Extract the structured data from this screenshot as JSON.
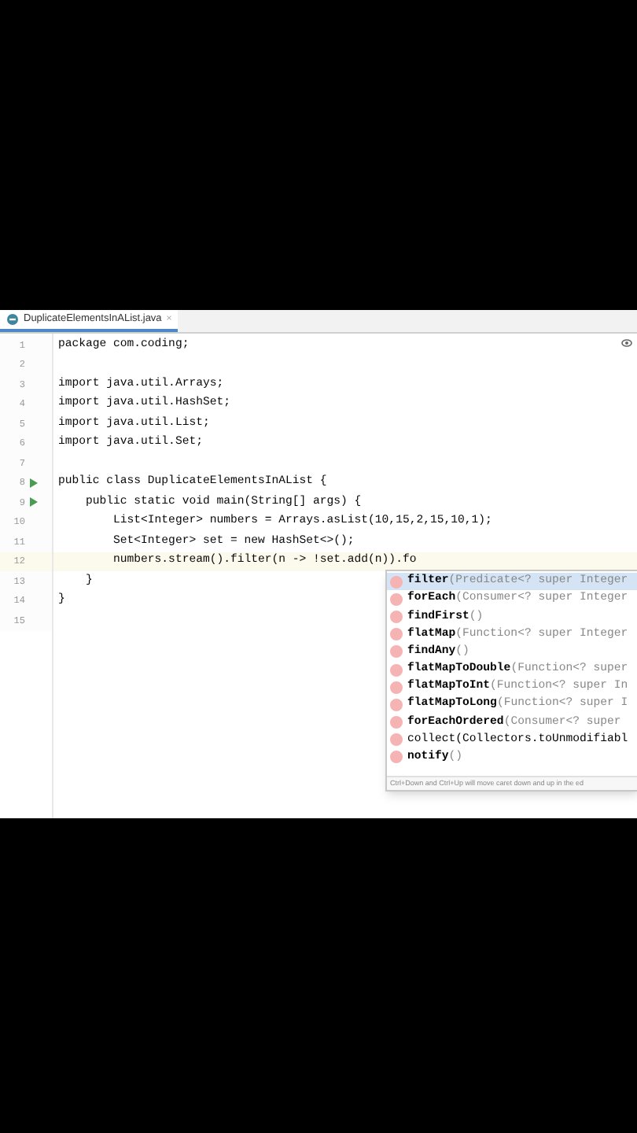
{
  "tab": {
    "label": "DuplicateElementsInAList.java",
    "close": "×",
    "selected": true
  },
  "lines": [
    {
      "number": "1",
      "code": "package com.coding;",
      "run": false,
      "current": false
    },
    {
      "number": "2",
      "run": false,
      "current": false
    },
    {
      "number": "3",
      "code": "import java.util.Arrays;",
      "run": false,
      "current": false
    },
    {
      "number": "4",
      "code": "import java.util.HashSet;",
      "run": false,
      "current": false
    },
    {
      "number": "5",
      "code": "import java.util.List;",
      "run": false,
      "current": false
    },
    {
      "number": "6",
      "code": "import java.util.Set;",
      "run": false,
      "current": false
    },
    {
      "number": "7",
      "run": false,
      "current": false
    },
    {
      "number": "8",
      "code": "public class DuplicateElementsInAList {",
      "run": true,
      "current": false
    },
    {
      "number": "9",
      "code": "    public static void main(String[] args) {",
      "run": true,
      "current": false
    },
    {
      "number": "10",
      "code": "        List<Integer> numbers = Arrays.asList(10,15,2,15,10,1);",
      "run": false,
      "current": false
    },
    {
      "number": "11",
      "code": "        Set<Integer> set = new HashSet<>();",
      "run": false,
      "current": false
    },
    {
      "number": "12",
      "code": "        numbers.stream().filter(n -> !set.add(n)).fo",
      "run": false,
      "current": true
    },
    {
      "number": "13",
      "code": "    }",
      "run": false,
      "current": false
    },
    {
      "number": "14",
      "code": "}",
      "run": false,
      "current": false
    },
    {
      "number": "15",
      "run": false,
      "current": false
    }
  ],
  "completion": {
    "items": [
      {
        "name": "filter",
        "detail": "(Predicate<? super Integer",
        "selected": true
      },
      {
        "name": "forEach",
        "detail": "(Consumer<? super Integer",
        "selected": false
      },
      {
        "name": "findFirst",
        "detail": "()",
        "selected": false
      },
      {
        "name": "flatMap",
        "detail": "(Function<? super Integer",
        "selected": false
      },
      {
        "name": "findAny",
        "detail": "()",
        "selected": false
      },
      {
        "name": "flatMapToDouble",
        "detail": "(Function<? super",
        "selected": false
      },
      {
        "name": "flatMapToInt",
        "detail": "(Function<? super In",
        "selected": false
      },
      {
        "name": "flatMapToLong",
        "detail": "(Function<? super I",
        "selected": false
      },
      {
        "name": "forEachOrdered",
        "detail": "(Consumer<? super",
        "selected": false
      },
      {
        "name": "collect(Collectors.toUnmodifiabl",
        "selected": false
      },
      {
        "name": "notify",
        "detail": "()",
        "selected": false
      }
    ],
    "hint": "Ctrl+Down and Ctrl+Up will move caret down and up in the ed"
  }
}
